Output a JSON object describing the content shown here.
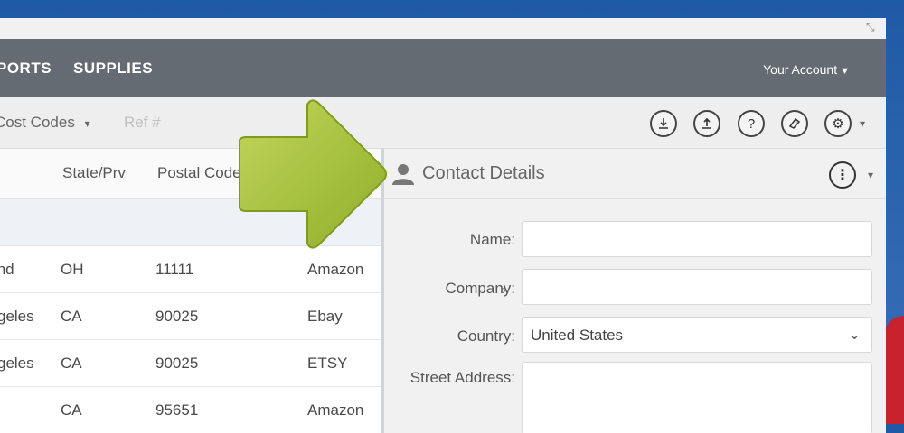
{
  "nav": {
    "items": [
      "PORTS",
      "SUPPLIES"
    ],
    "account_label": "Your Account"
  },
  "toolbar": {
    "cost_codes_label": "Cost Codes",
    "ref_placeholder": "Ref #",
    "icons": [
      "download-icon",
      "upload-icon",
      "help-icon",
      "label-icon",
      "gear-icon"
    ]
  },
  "table": {
    "headers": [
      "State/Prv",
      "Postal Code"
    ],
    "rows": [
      {
        "city": "Cleveland",
        "state": "OH",
        "postal": "11111",
        "source": "Amazon"
      },
      {
        "city": "Los Angeles",
        "state": "CA",
        "postal": "90025",
        "source": "Ebay"
      },
      {
        "city": "Los Angeles",
        "state": "CA",
        "postal": "90025",
        "source": "ETSY"
      },
      {
        "city": "",
        "state": "CA",
        "postal": "95651",
        "source": "Amazon"
      }
    ]
  },
  "contact": {
    "title": "Contact Details",
    "name_label": "Name:",
    "company_label": "Company:",
    "country_label": "Country:",
    "country_value": "United States",
    "street_label": "Street Address:"
  },
  "colors": {
    "navbar": "#646b73",
    "arrow": "#a8c03a",
    "background": "#2a63ad"
  }
}
